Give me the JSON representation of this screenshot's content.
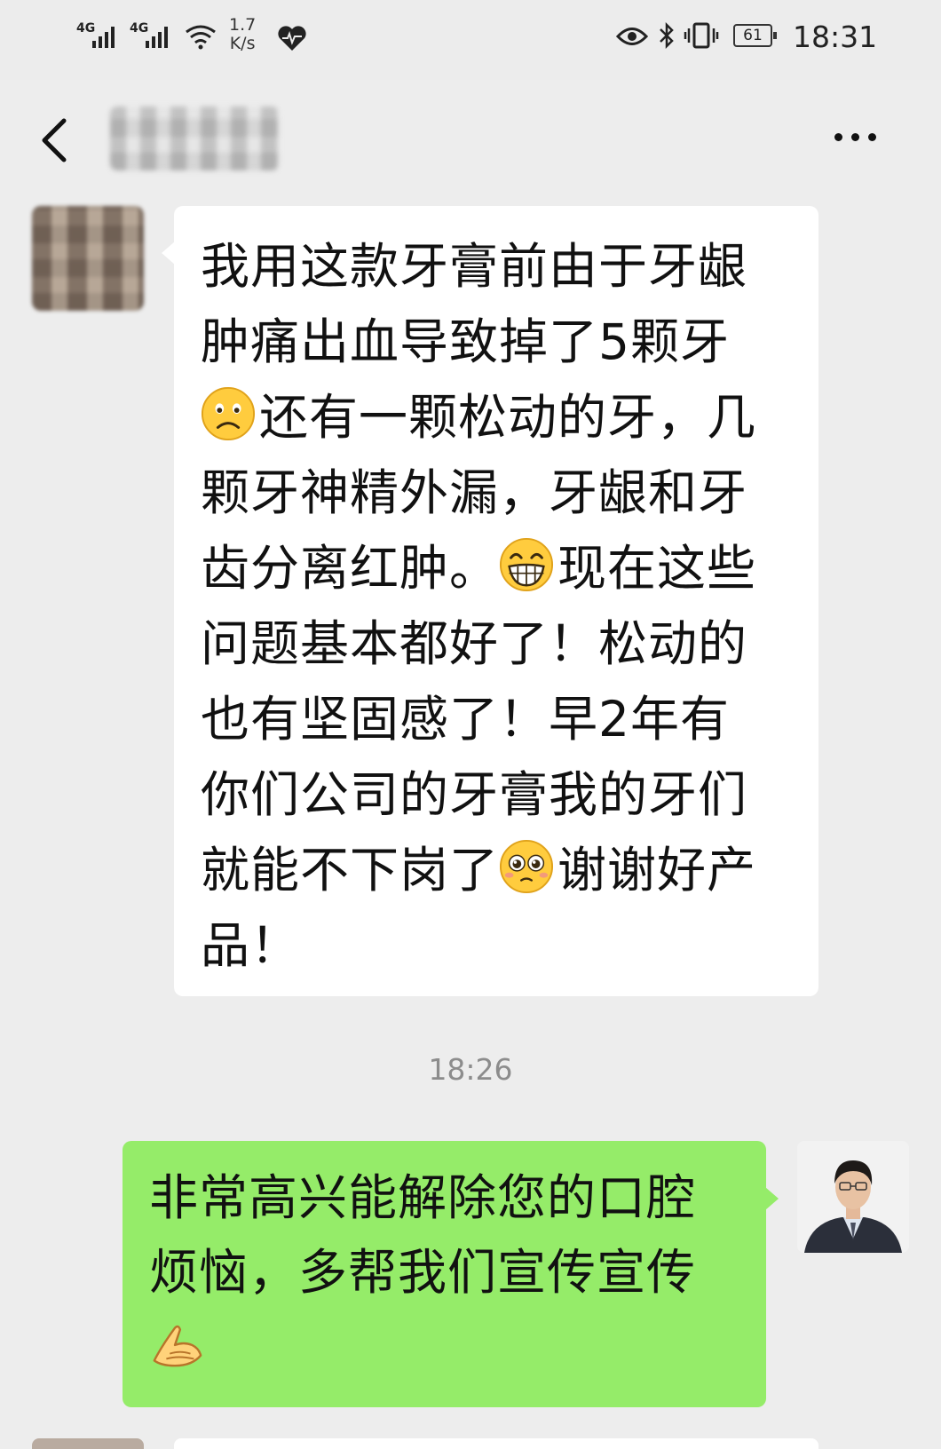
{
  "status_bar": {
    "signal1": "4G",
    "signal2": "4G",
    "speed_value": "1.7",
    "speed_unit": "K/s",
    "battery": "61",
    "time": "18:31"
  },
  "title_bar": {
    "back_icon": "chevron-left-icon",
    "more_icon": "more-dots-icon"
  },
  "messages": [
    {
      "side": "left",
      "lines": [
        [
          "我用这款牙膏前由于牙龈"
        ],
        [
          "肿痛出血导致掉了5颗牙"
        ],
        [
          {
            "emoji": "sad-face-icon"
          },
          "还有一颗松动的牙，几"
        ],
        [
          "颗牙神精外漏，牙龈和牙"
        ],
        [
          "齿分离红肿。",
          {
            "emoji": "grin-face-icon"
          },
          "现在这些"
        ],
        [
          "问题基本都好了！松动的"
        ],
        [
          "也有坚固感了！早2年有"
        ],
        [
          "你们公司的牙膏我的牙们"
        ],
        [
          "就能不下岗了",
          {
            "emoji": "pleading-face-icon"
          },
          "谢谢好产"
        ],
        [
          "品！"
        ]
      ]
    },
    {
      "side": "right",
      "lines": [
        [
          "非常高兴能解除您的口腔"
        ],
        [
          "烦恼，多帮我们宣传宣传"
        ],
        [
          {
            "emoji": "pray-hands-icon"
          }
        ]
      ]
    }
  ],
  "timestamp": "18:26",
  "colors": {
    "background": "#ededed",
    "bubble_left": "#ffffff",
    "bubble_right": "#95ec69",
    "timestamp": "#8c8c8c"
  }
}
